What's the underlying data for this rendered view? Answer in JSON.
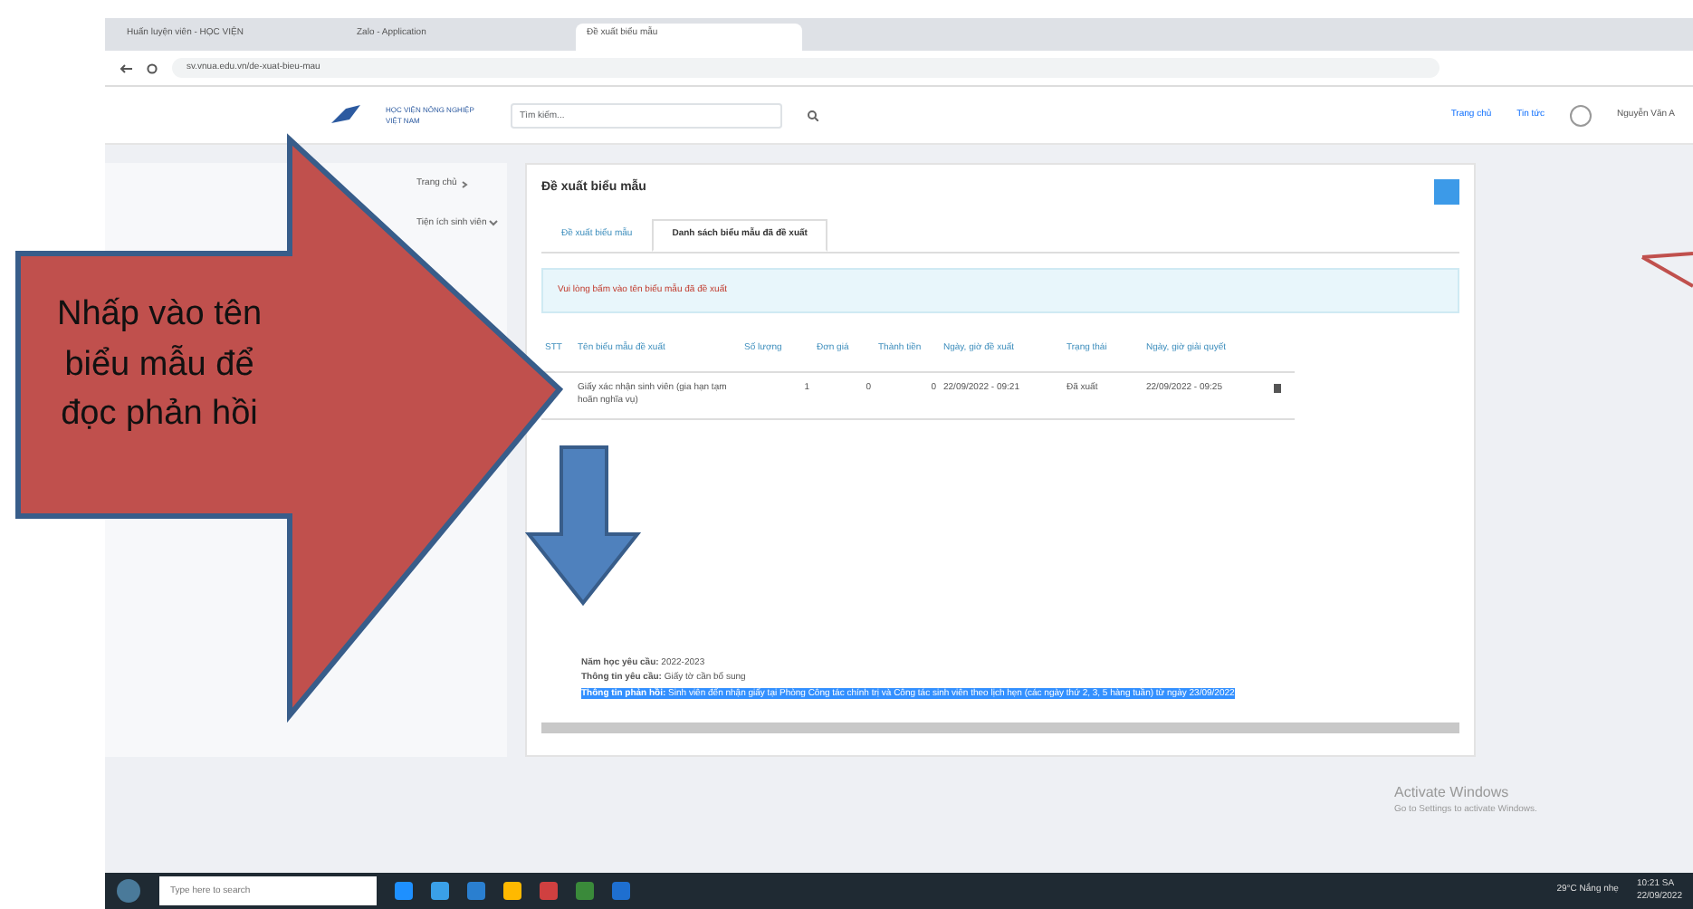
{
  "browser": {
    "tabs": [
      {
        "label": "Huấn luyện viên - HỌC VIỆN",
        "selected": false
      },
      {
        "label": "Zalo - Application",
        "selected": false
      },
      {
        "label": "Đề xuất biểu mẫu",
        "selected": true
      }
    ],
    "url": "sv.vnua.edu.vn/de-xuat-bieu-mau"
  },
  "site_header": {
    "logo_text": "HỌC VIỆN NÔNG NGHIỆP VIỆT NAM",
    "search": {
      "placeholder": "Tìm kiếm..."
    },
    "links": [
      "Trang chủ",
      "Tin tức"
    ],
    "user": "Nguyễn Văn A"
  },
  "sidebar": {
    "items": [
      {
        "label": "Trang chủ",
        "expanded": false
      },
      {
        "label": "Tiện ích sinh viên",
        "expanded": true
      }
    ]
  },
  "main": {
    "title": "Đề xuất biểu mẫu",
    "tabs": [
      {
        "label": "Đề xuất biểu mẫu",
        "selected": false
      },
      {
        "label": "Danh sách biểu mẫu đã đề xuất",
        "selected": true
      }
    ],
    "alert": "Vui lòng bấm vào tên biểu mẫu đã đề xuất",
    "table": {
      "columns": [
        "STT",
        "Tên biểu mẫu đề xuất",
        "Số lượng",
        "Đơn giá",
        "Thành tiền",
        "Ngày, giờ đề xuất",
        "Trạng thái",
        "Ngày, giờ giải quyết"
      ],
      "rows": [
        {
          "cells": [
            "",
            "Giấy xác nhận sinh viên (gia hạn tạm hoãn nghĩa vụ)",
            "1",
            "0",
            "0",
            "22/09/2022 - 09:21",
            "Đã xuất",
            "22/09/2022 - 09:25"
          ]
        }
      ]
    },
    "details": [
      "**Năm học yêu cầu:** 2022-2023",
      "**Thông tin yêu cầu:** Giấy tờ cần bổ sung"
    ],
    "feedback": "**Thông tin phản hồi:** Sinh viên đến nhận giấy tại Phòng Công tác chính trị và Công tác sinh viên theo lịch hẹn (các ngày thứ 2, 3, 5 hàng tuần) từ ngày 23/09/2022"
  },
  "annotation": {
    "text": "Nhấp vào tên biểu mẫu để đọc phản hồi"
  },
  "os_watermark": [
    "Activate Windows",
    "Go to Settings to activate Windows."
  ],
  "taskbar": {
    "search": {
      "placeholder": "Type here to search"
    },
    "weather": "29°C Nắng nhẹ",
    "time": "10:21 SA",
    "date": "22/09/2022"
  }
}
